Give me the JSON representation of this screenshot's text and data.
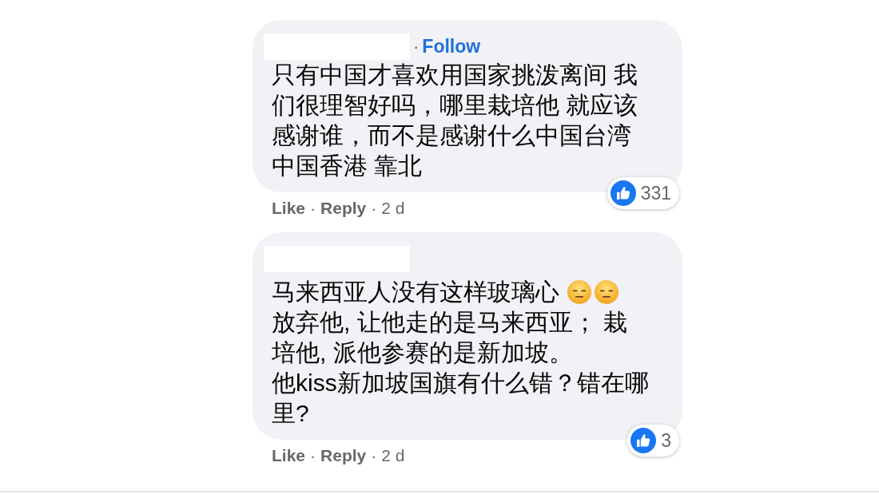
{
  "separator": "·",
  "comments": [
    {
      "follow": "Follow",
      "paragraphs": [
        {
          "text": "只有中国才喜欢用国家挑泼离间 我们很理智好吗，哪里栽培他 就应该感谢谁，而不是感谢什么中国台湾中国香港 靠北"
        }
      ],
      "actions": [
        {
          "label": "Like"
        },
        {
          "label": "Reply"
        }
      ],
      "time": "2 d",
      "reactions": "331"
    },
    {
      "paragraphs": [
        {
          "text": "马来西亚人没有这样玻璃心",
          "emojis": [
            {
              "kind": "expressionless"
            },
            {
              "kind": "expressionless"
            }
          ]
        },
        {
          "text": "放弃他, 让他走的是马来西亚； 栽培他, 派他参赛的是新加坡。"
        },
        {
          "text": "他kiss新加坡国旗有什么错？错在哪里?"
        }
      ],
      "actions": [
        {
          "label": "Like"
        },
        {
          "label": "Reply"
        }
      ],
      "time": "2 d",
      "reactions": "3"
    }
  ]
}
